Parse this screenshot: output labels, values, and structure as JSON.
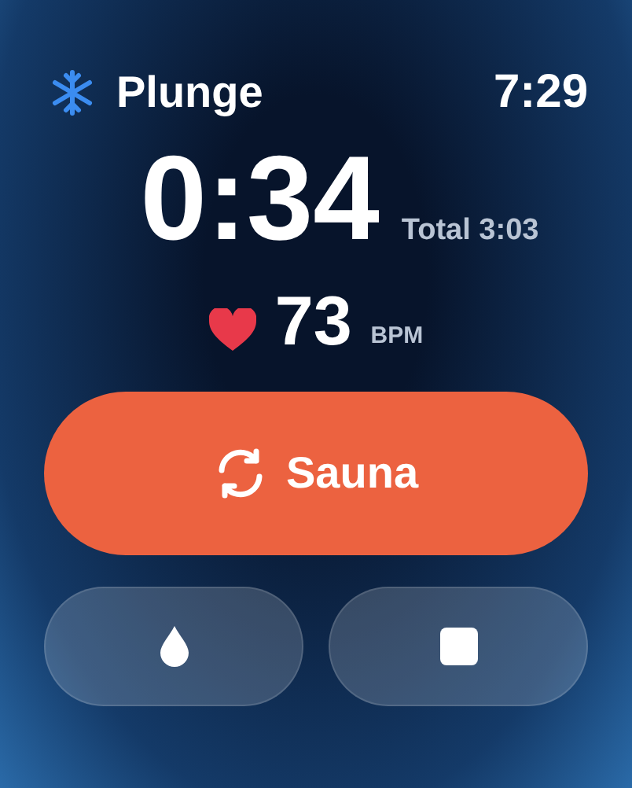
{
  "header": {
    "title": "Plunge",
    "time": "7:29"
  },
  "timer": {
    "elapsed": "0:34",
    "total": "Total 3:03"
  },
  "heart_rate": {
    "value": "73",
    "unit": "BPM"
  },
  "primary_button": {
    "label": "Sauna"
  },
  "secondary_buttons": [
    {
      "kind": "drop"
    },
    {
      "kind": "stop"
    }
  ]
}
